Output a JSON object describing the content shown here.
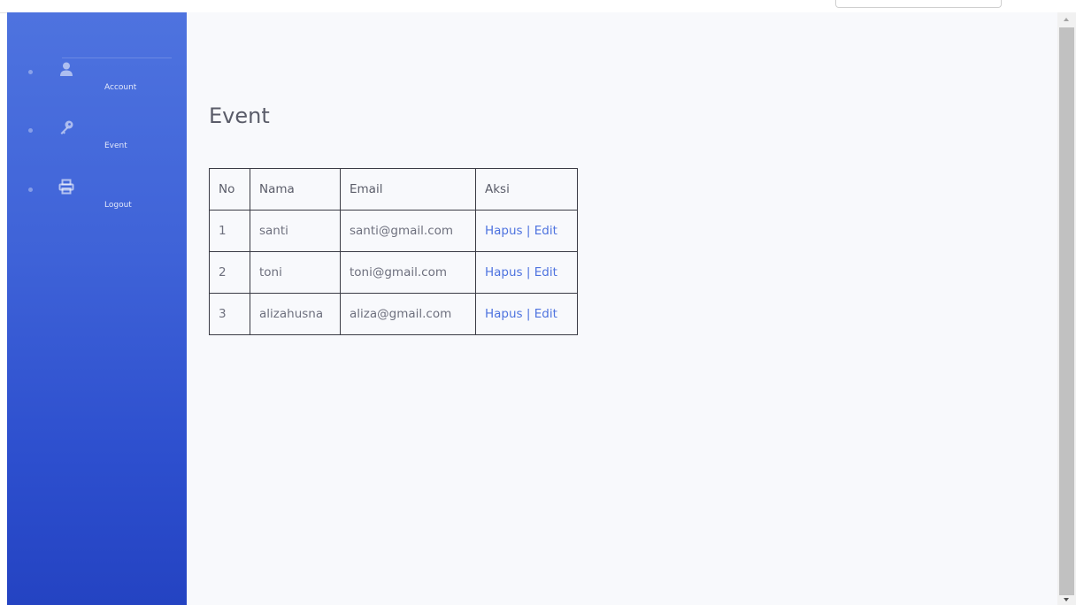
{
  "sidebar": {
    "items": [
      {
        "label": "Account",
        "icon": "user-icon"
      },
      {
        "label": "Event",
        "icon": "key-icon"
      },
      {
        "label": "Logout",
        "icon": "print-icon"
      }
    ]
  },
  "main": {
    "title": "Event",
    "table": {
      "headers": [
        "No",
        "Nama",
        "Email",
        "Aksi"
      ],
      "rows": [
        {
          "no": "1",
          "nama": "santi",
          "email": "santi@gmail.com",
          "hapus": "Hapus",
          "separator": "|",
          "edit": "Edit"
        },
        {
          "no": "2",
          "nama": "toni",
          "email": "toni@gmail.com",
          "hapus": "Hapus",
          "separator": "|",
          "edit": "Edit"
        },
        {
          "no": "3",
          "nama": "alizahusna",
          "email": "aliza@gmail.com",
          "hapus": "Hapus",
          "separator": "|",
          "edit": "Edit"
        }
      ]
    }
  },
  "colors": {
    "sidebar_top": "#4e73df",
    "sidebar_bottom": "#2443c2",
    "link": "#4e73df",
    "background": "#f8f9fc",
    "text": "#6e707e"
  }
}
